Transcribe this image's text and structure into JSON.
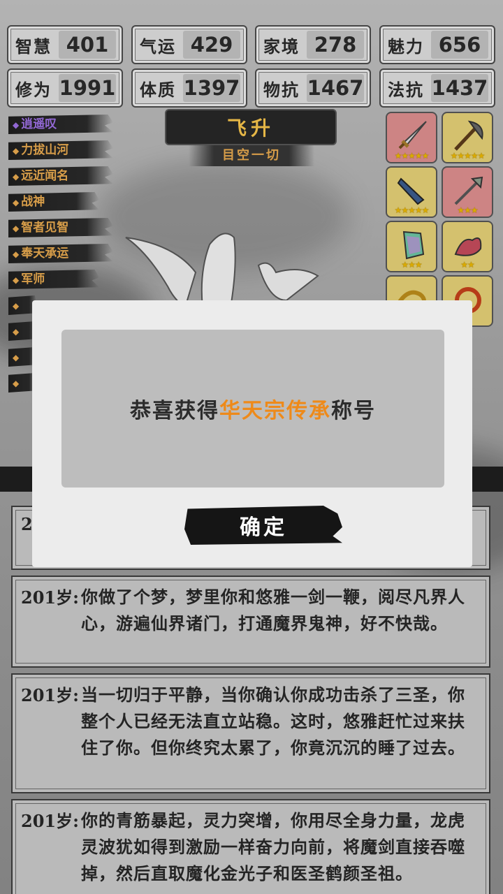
{
  "stats": [
    {
      "label": "智慧",
      "value": "401"
    },
    {
      "label": "气运",
      "value": "429"
    },
    {
      "label": "家境",
      "value": "278"
    },
    {
      "label": "魅力",
      "value": "656"
    },
    {
      "label": "修为",
      "value": "1991"
    },
    {
      "label": "体质",
      "value": "1397"
    },
    {
      "label": "物抗",
      "value": "1467"
    },
    {
      "label": "法抗",
      "value": "1437"
    }
  ],
  "titles": [
    "逍遥叹",
    "力拔山河",
    "远近闻名",
    "战神",
    "智者见智",
    "奉天承运",
    "军师"
  ],
  "rank": {
    "name": "飞升",
    "subtitle": "目空一切"
  },
  "logs": [
    {
      "age": "201岁:",
      "text": "你做了个梦，梦里你和悠雅一剑一鞭，阅尽凡界人心，游遍仙界诸门，打通魔界鬼神，好不快哉。"
    },
    {
      "age": "201岁:",
      "text": "当一切归于平静，当你确认你成功击杀了三圣，你整个人已经无法直立站稳。这时，悠雅赶忙过来扶住了你。但你终究太累了，你竟沉沉的睡了过去。"
    },
    {
      "age": "201岁:",
      "text": "你的青筋暴起，灵力突增，你用尽全身力量，龙虎灵波犹如得到激励一样奋力向前，将魔剑直接吞噬掉，然后直取魔化金光子和医圣鹤颜圣祖。"
    }
  ],
  "partial_log_age": "20",
  "modal": {
    "prefix": "恭喜获得",
    "highlight": "华天宗传承",
    "suffix": "称号",
    "confirm_label": "确定",
    "highlight_color": "#ee8a1a"
  }
}
